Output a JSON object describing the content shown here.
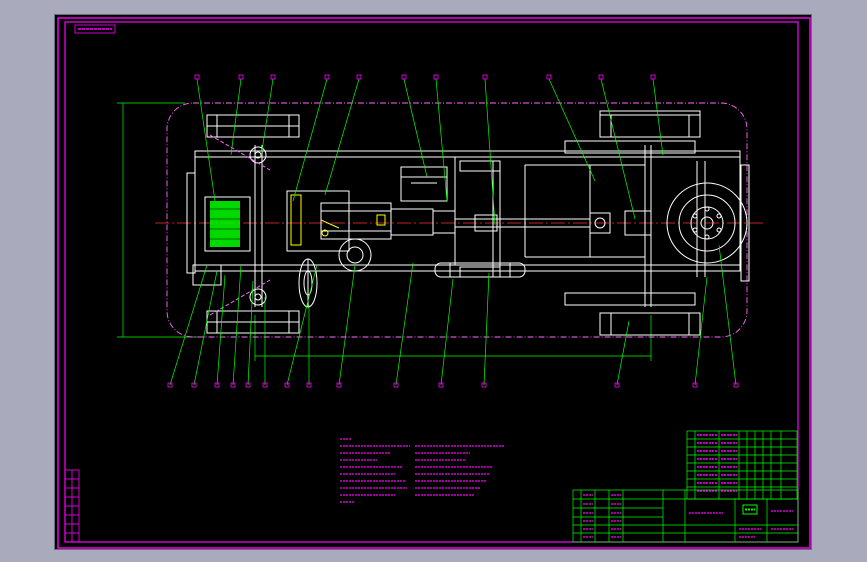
{
  "viewport": {
    "background": "#000000"
  },
  "colors": {
    "border": "#ff00ff",
    "outline": "#ffffff",
    "leader": "#00ff00",
    "centerline": "#ff3030",
    "dimension": "#00ff00",
    "tables": "#00ff00",
    "text": "#ff00ff"
  },
  "drawing": {
    "title_tag": "",
    "notes_title": "",
    "dimension_height": "",
    "dimension_length": ""
  }
}
